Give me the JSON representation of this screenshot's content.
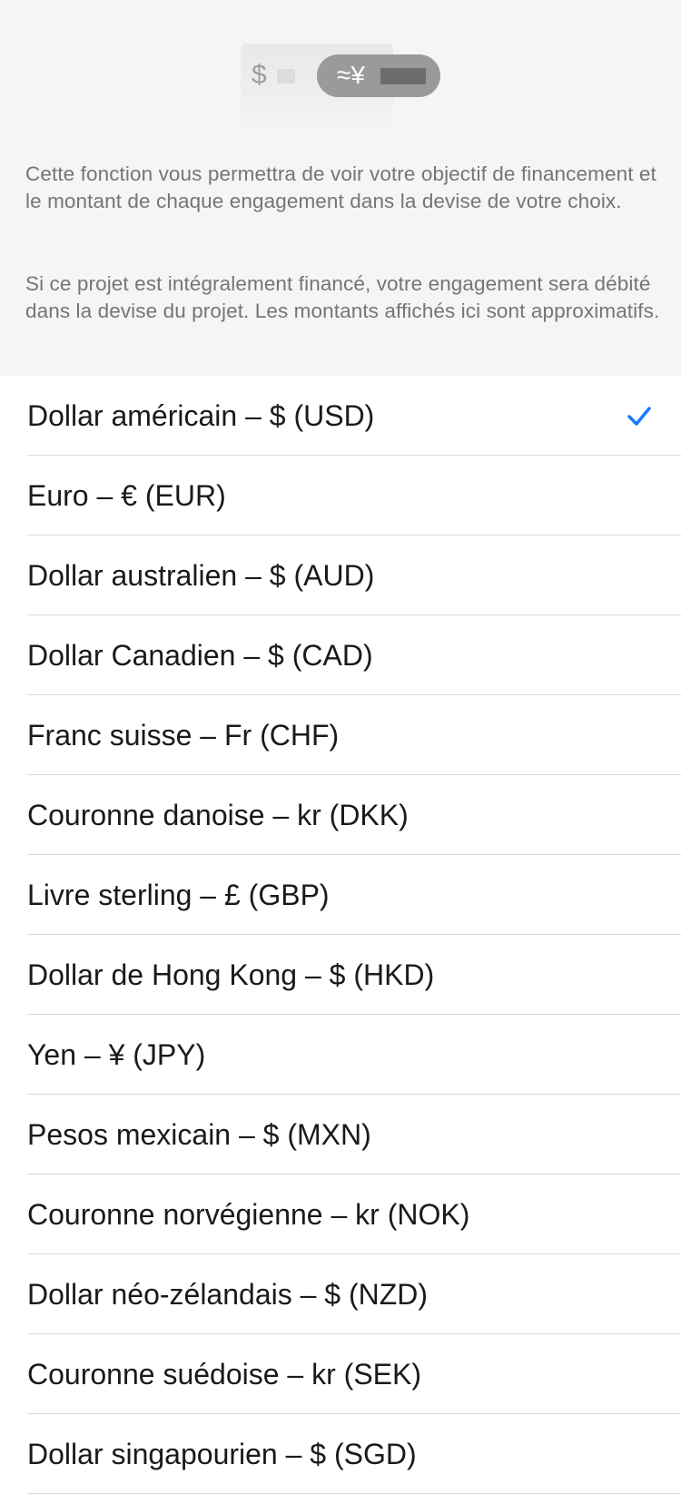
{
  "illustration": {
    "from_symbol": "$",
    "to_symbol": "≈¥"
  },
  "description": {
    "paragraph_1": "Cette fonction vous permettra de voir votre objectif de financement et le montant de chaque engagement dans la devise de votre choix.",
    "paragraph_2": "Si ce projet est intégralement financé, votre engagement sera débité dans la devise du projet. Les montants affichés ici sont approximatifs."
  },
  "accent_color": "#1a7bff",
  "selected_currency": "USD",
  "selected_icon": "checkmark-icon",
  "currencies": [
    {
      "code": "USD",
      "label": "Dollar américain – $ (USD)"
    },
    {
      "code": "EUR",
      "label": "Euro – € (EUR)"
    },
    {
      "code": "AUD",
      "label": "Dollar australien – $ (AUD)"
    },
    {
      "code": "CAD",
      "label": "Dollar Canadien – $ (CAD)"
    },
    {
      "code": "CHF",
      "label": "Franc suisse – Fr (CHF)"
    },
    {
      "code": "DKK",
      "label": "Couronne danoise – kr (DKK)"
    },
    {
      "code": "GBP",
      "label": "Livre sterling – £ (GBP)"
    },
    {
      "code": "HKD",
      "label": "Dollar de Hong Kong – $ (HKD)"
    },
    {
      "code": "JPY",
      "label": "Yen – ¥ (JPY)"
    },
    {
      "code": "MXN",
      "label": "Pesos mexicain – $ (MXN)"
    },
    {
      "code": "NOK",
      "label": "Couronne norvégienne – kr (NOK)"
    },
    {
      "code": "NZD",
      "label": "Dollar néo-zélandais – $ (NZD)"
    },
    {
      "code": "SEK",
      "label": "Couronne suédoise – kr (SEK)"
    },
    {
      "code": "SGD",
      "label": "Dollar singapourien – $ (SGD)"
    }
  ]
}
